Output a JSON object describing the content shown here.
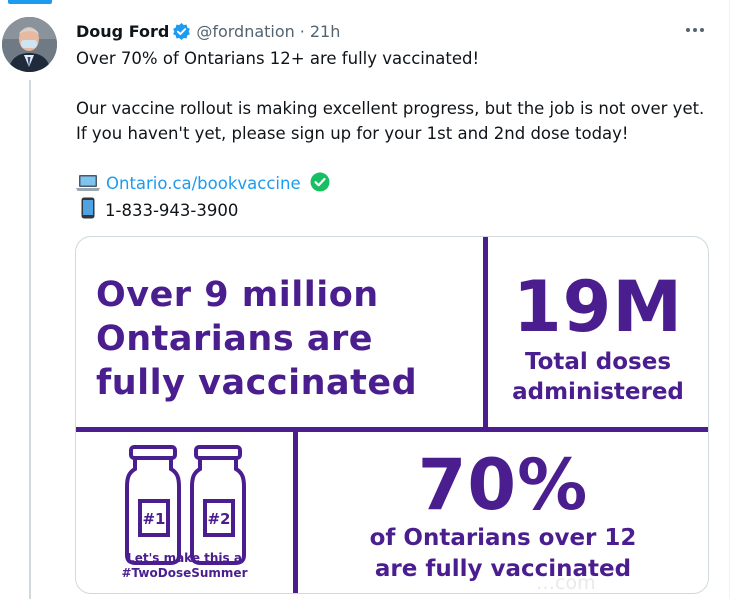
{
  "tweet": {
    "author_name": "Doug Ford",
    "author_handle": "@fordnation",
    "separator": "·",
    "timestamp": "21h",
    "line1": "Over 70% of Ontarians 12+ are fully vaccinated!",
    "line2": "Our vaccine rollout is making excellent progress, but the job is not over yet.",
    "line3": "If you haven't yet, please sign up for your 1st and 2nd dose today!",
    "link_text": "Ontario.ca/bookvaccine",
    "phone": "1-833-943-3900",
    "icons": {
      "verified": "verified-badge-icon",
      "more": "more-options-icon",
      "laptop": "laptop-icon",
      "check": "check-mark-button-icon",
      "phone": "mobile-phone-icon"
    }
  },
  "card": {
    "left_line1_a": "Over ",
    "left_line1_b": "9 million",
    "left_line2": "Ontarians are",
    "left_line3": "fully vaccinated",
    "total_number": "19M",
    "total_label_1": "Total doses",
    "total_label_2": "administered",
    "pct_number": "70%",
    "pct_label_1": "of Ontarians over 12",
    "pct_label_2": "are fully vaccinated",
    "bottle1_label": "#1",
    "bottle2_label": "#2",
    "summer_line1": "Let's make this a",
    "summer_line2": "#TwoDoseSummer"
  },
  "watermark": "…com",
  "colors": {
    "accent": "#1d9bf0",
    "brand_purple": "#4b1e8f",
    "check_green": "#17bf63"
  }
}
